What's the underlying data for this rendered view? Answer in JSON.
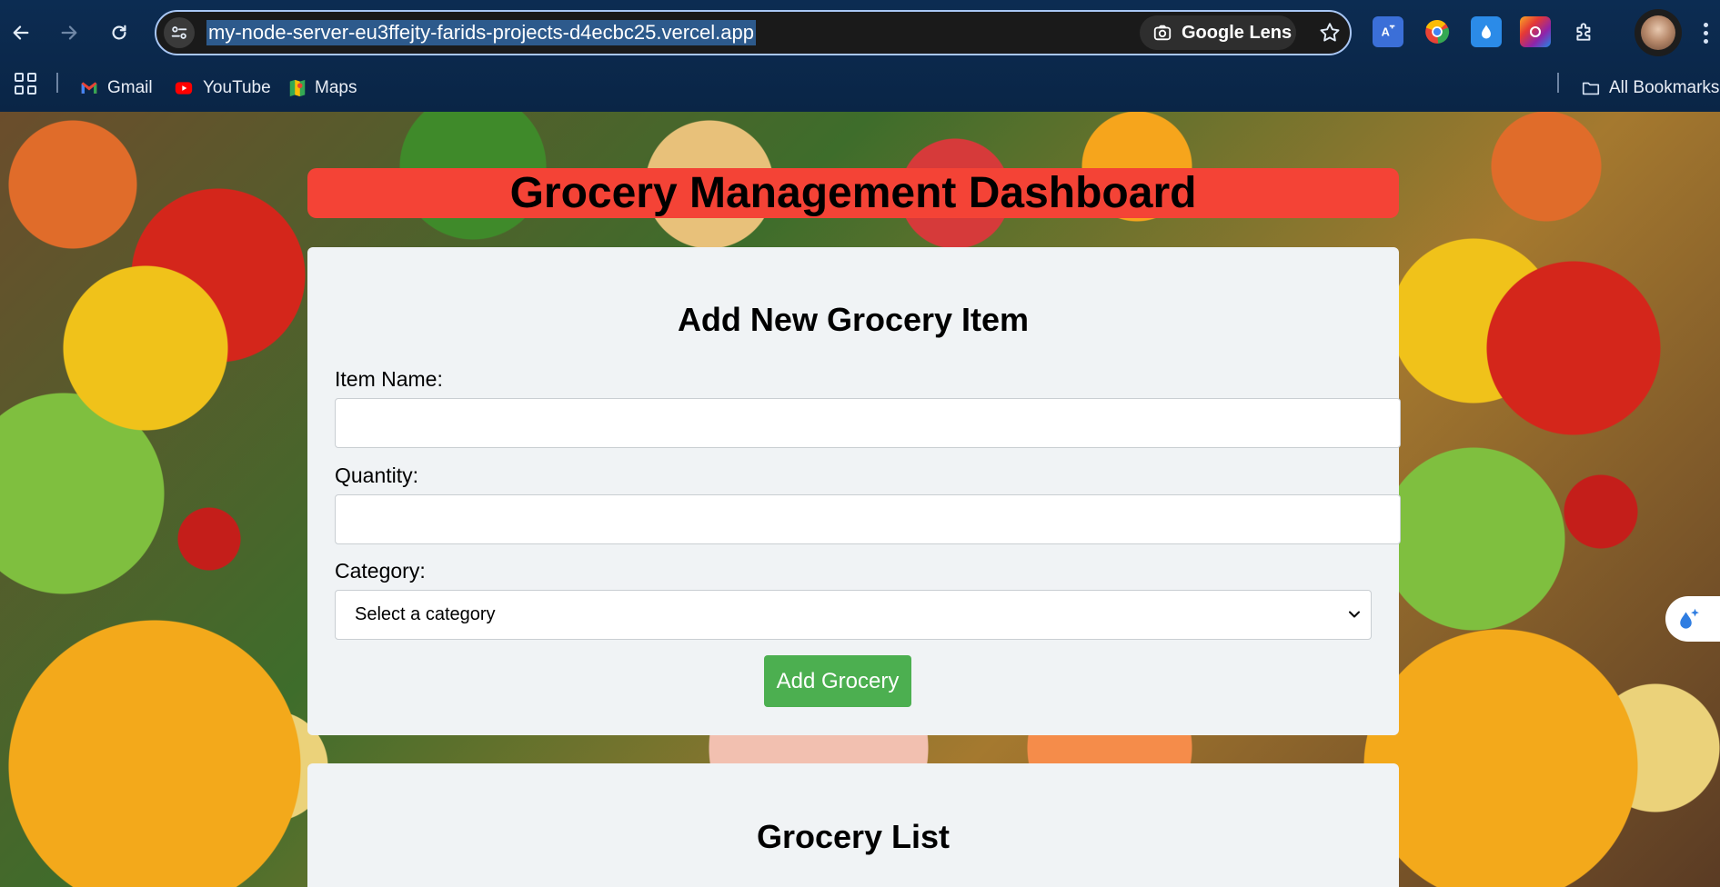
{
  "browser": {
    "url": "my-node-server-eu3ffejty-farids-projects-d4ecbc25.vercel.app",
    "lens_label": "Google Lens",
    "bookmarks": [
      {
        "label": "Gmail",
        "icon": "gmail-icon"
      },
      {
        "label": "YouTube",
        "icon": "youtube-icon"
      },
      {
        "label": "Maps",
        "icon": "maps-icon"
      }
    ],
    "all_bookmarks_label": "All Bookmarks"
  },
  "page": {
    "title": "Grocery Management Dashboard",
    "form": {
      "heading": "Add New Grocery Item",
      "item_name_label": "Item Name:",
      "item_name_value": "",
      "quantity_label": "Quantity:",
      "quantity_value": "",
      "category_label": "Category:",
      "category_selected": "Select a category",
      "submit_label": "Add Grocery"
    },
    "list": {
      "heading": "Grocery List"
    }
  },
  "colors": {
    "title_bar": "#f44336",
    "button": "#4caf50",
    "card": "#f0f3f5",
    "chrome": "#0c2c52"
  }
}
